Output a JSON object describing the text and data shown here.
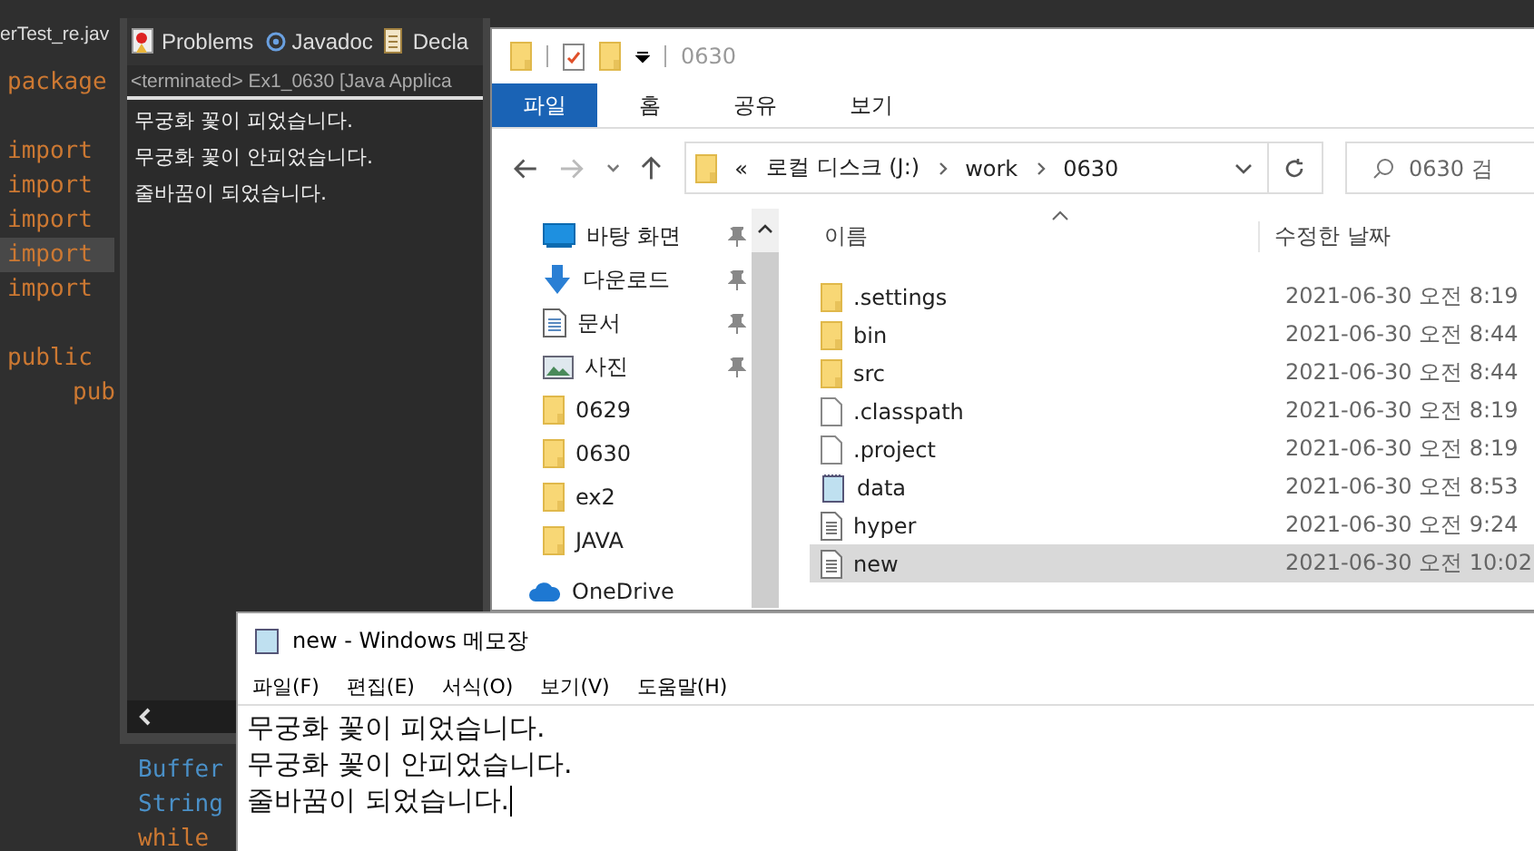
{
  "editor": {
    "tab": "erTest_re.jav",
    "lines": [
      {
        "kind": "keyword",
        "text": "package",
        "current": false
      },
      {
        "kind": "blank"
      },
      {
        "kind": "keyword",
        "text": "import",
        "current": false
      },
      {
        "kind": "keyword",
        "text": "import",
        "current": false
      },
      {
        "kind": "keyword",
        "text": "import",
        "current": false
      },
      {
        "kind": "keyword",
        "text": "import",
        "current": true
      },
      {
        "kind": "keyword",
        "text": "import",
        "current": false
      },
      {
        "kind": "blank"
      },
      {
        "kind": "keyword",
        "text": "public",
        "current": false
      },
      {
        "kind": "indented",
        "text": "pub",
        "current": false
      }
    ],
    "bottom_lines": [
      {
        "kind": "type",
        "text": "Buffer"
      },
      {
        "kind": "type",
        "text": "String"
      },
      {
        "kind": "keyword",
        "text": "while"
      }
    ]
  },
  "console": {
    "tabs": [
      {
        "kind": "problems",
        "label": "Problems"
      },
      {
        "kind": "javadoc",
        "label": "Javadoc"
      },
      {
        "kind": "declaration",
        "label": "Decla"
      }
    ],
    "status": "<terminated> Ex1_0630 [Java Applica",
    "output": [
      "무궁화 꽃이 피었습니다.",
      "무궁화 꽃이 안피었습니다.",
      "줄바꿈이 되었습니다."
    ]
  },
  "explorer": {
    "title": "0630",
    "ribbon_tabs": [
      {
        "label": "파일",
        "selected": true
      },
      {
        "label": "홈",
        "selected": false
      },
      {
        "label": "공유",
        "selected": false
      },
      {
        "label": "보기",
        "selected": false
      }
    ],
    "address": {
      "prefix": "«",
      "crumbs": [
        "로컬 디스크 (J:)",
        "work",
        "0630"
      ]
    },
    "search": {
      "placeholder": "0630 검"
    },
    "nav": [
      {
        "kind": "desktop",
        "label": "바탕 화면",
        "pinned": true
      },
      {
        "kind": "download",
        "label": "다운로드",
        "pinned": true
      },
      {
        "kind": "document",
        "label": "문서",
        "pinned": true
      },
      {
        "kind": "picture",
        "label": "사진",
        "pinned": true
      },
      {
        "kind": "folder",
        "label": "0629",
        "pinned": false
      },
      {
        "kind": "folder",
        "label": "0630",
        "pinned": false
      },
      {
        "kind": "folder",
        "label": "ex2",
        "pinned": false
      },
      {
        "kind": "folder",
        "label": "JAVA",
        "pinned": false
      },
      {
        "kind": "cloud",
        "label": "OneDrive",
        "pinned": false
      }
    ],
    "columns": [
      "이름",
      "수정한 날짜"
    ],
    "files": [
      {
        "kind": "folder",
        "name": ".settings",
        "date": "2021-06-30 오전 8:19",
        "selected": false
      },
      {
        "kind": "folder",
        "name": "bin",
        "date": "2021-06-30 오전 8:44",
        "selected": false
      },
      {
        "kind": "folder",
        "name": "src",
        "date": "2021-06-30 오전 8:44",
        "selected": false
      },
      {
        "kind": "blank",
        "name": ".classpath",
        "date": "2021-06-30 오전 8:19",
        "selected": false
      },
      {
        "kind": "blank",
        "name": ".project",
        "date": "2021-06-30 오전 8:19",
        "selected": false
      },
      {
        "kind": "notepad",
        "name": "data",
        "date": "2021-06-30 오전 8:53",
        "selected": false
      },
      {
        "kind": "text",
        "name": "hyper",
        "date": "2021-06-30 오전 9:24",
        "selected": false
      },
      {
        "kind": "text",
        "name": "new",
        "date": "2021-06-30 오전 10:02",
        "selected": true
      }
    ]
  },
  "notepad": {
    "title": "new - Windows 메모장",
    "menu": [
      "파일(F)",
      "편집(E)",
      "서식(O)",
      "보기(V)",
      "도움말(H)"
    ],
    "lines": [
      "무궁화 꽃이 피었습니다.",
      "무궁화 꽃이 안피었습니다.",
      "줄바꿈이 되었습니다."
    ]
  }
}
